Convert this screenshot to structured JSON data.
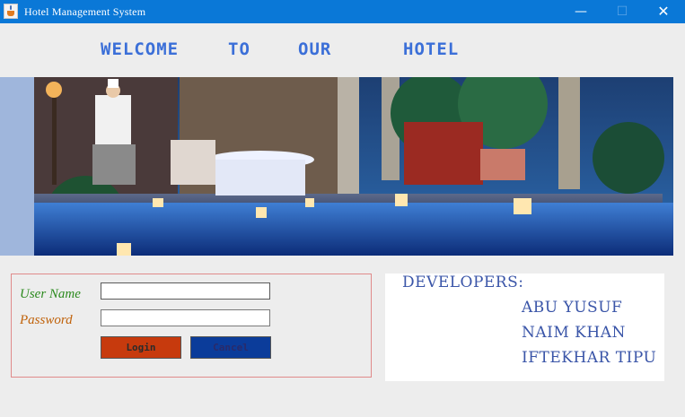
{
  "window": {
    "title": "Hotel Management System",
    "minimize_icon": "—",
    "maximize_icon": "☐",
    "close_icon": "✕"
  },
  "welcome": {
    "words": [
      "WELCOME",
      "TO",
      "OUR",
      "HOTEL"
    ],
    "color": "#3b6fd8"
  },
  "banner": {
    "description_icon": "hotel-poolside-photo"
  },
  "login": {
    "username_label": "User Name",
    "password_label": "Password",
    "username_value": "",
    "password_value": "",
    "login_button": "Login",
    "cancel_button": "Cancel",
    "login_color": "#c73a0d",
    "cancel_color": "#0b3c9a"
  },
  "developers": {
    "title": "DEVELOPERS:",
    "names": [
      "ABU YUSUF",
      "NAIM KHAN",
      "IFTEKHAR TIPU"
    ],
    "color": "#3a55a8"
  }
}
